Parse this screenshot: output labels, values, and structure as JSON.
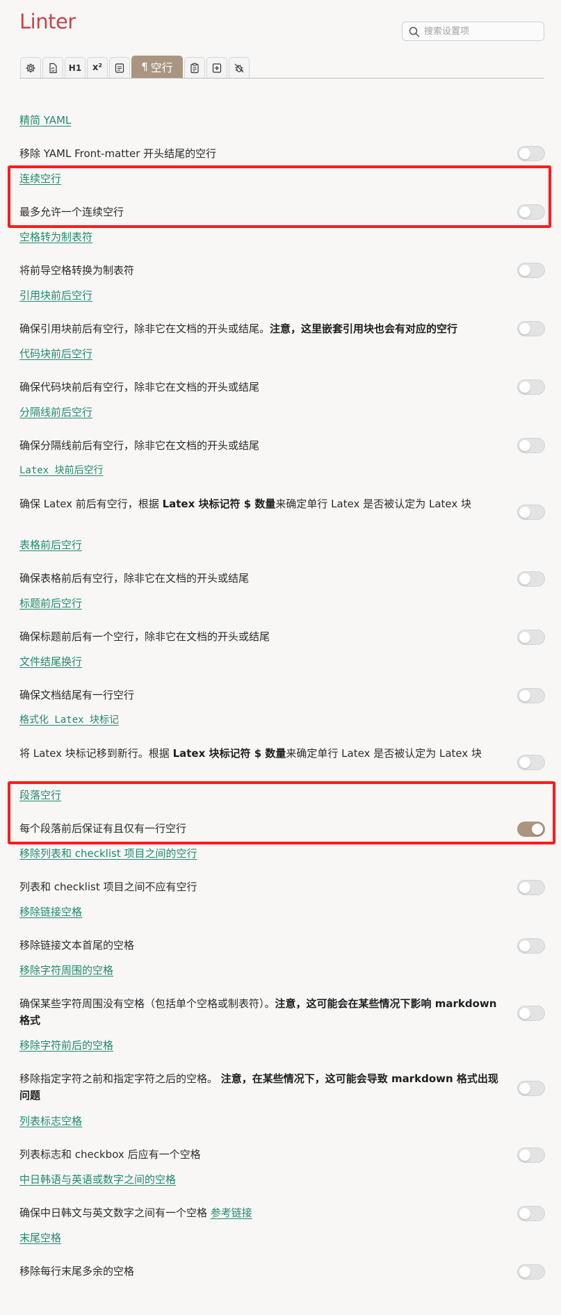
{
  "app": {
    "title": "Linter"
  },
  "search": {
    "placeholder": "搜索设置项",
    "value": ""
  },
  "tabs": [
    {
      "icon": "gear-icon",
      "label": ""
    },
    {
      "icon": "file-sync-icon",
      "label": ""
    },
    {
      "icon": "heading-icon",
      "label": "H1"
    },
    {
      "icon": "superscript-icon",
      "label": "x²"
    },
    {
      "icon": "file-text-icon",
      "label": ""
    },
    {
      "icon": "pilcrow-icon",
      "label": "空行",
      "active": true
    },
    {
      "icon": "clipboard-icon",
      "label": ""
    },
    {
      "icon": "file-plus-icon",
      "label": ""
    },
    {
      "icon": "bug-off-icon",
      "label": ""
    }
  ],
  "rules": [
    {
      "title": "精简 YAML",
      "desc": "移除 YAML Front-matter 开头结尾的空行",
      "enabled": false
    },
    {
      "title": "连续空行",
      "desc": "最多允许一个连续空行",
      "enabled": false
    },
    {
      "title": "空格转为制表符",
      "desc": "将前导空格转换为制表符",
      "enabled": false
    },
    {
      "title": "引用块前后空行",
      "desc_before": "确保引用块前后有空行，除非它在文档的开头或结尾。",
      "desc_bold": "注意，这里嵌套引用块也会有对应的空行",
      "enabled": false
    },
    {
      "title": "代码块前后空行",
      "desc": "确保代码块前后有空行，除非它在文档的开头或结尾",
      "enabled": false
    },
    {
      "title": "分隔线前后空行",
      "desc": "确保分隔线前后有空行，除非它在文档的开头或结尾",
      "enabled": false
    },
    {
      "title": "Latex 块前后空行",
      "desc_1": "确保 Latex 前后有空行，根据 ",
      "desc_2": "Latex 块标记符 $ 数量",
      "desc_3": "来确定单行 Latex 是否被认定为 Latex 块",
      "enabled": false
    },
    {
      "title": "表格前后空行",
      "desc": "确保表格前后有空行，除非它在文档的开头或结尾",
      "enabled": false
    },
    {
      "title": "标题前后空行",
      "desc": "确保标题前后有一个空行，除非它在文档的开头或结尾",
      "enabled": false
    },
    {
      "title": "文件结尾换行",
      "desc": "确保文档结尾有一行空行",
      "enabled": false
    },
    {
      "title": "格式化 Latex 块标记",
      "desc_1": "将 Latex 块标记移到新行。根据 ",
      "desc_2": "Latex 块标记符 $ 数量",
      "desc_3": "来确定单行 Latex 是否被认定为 Latex 块",
      "enabled": false
    },
    {
      "title": "段落空行",
      "desc": "每个段落前后保证有且仅有一行空行",
      "enabled": true
    },
    {
      "title": "移除列表和 checklist 项目之间的空行",
      "desc": "列表和 checklist 项目之间不应有空行",
      "enabled": false
    },
    {
      "title": "移除链接空格",
      "desc": "移除链接文本首尾的空格",
      "enabled": false
    },
    {
      "title": "移除字符周围的空格",
      "desc_before": "确保某些字符周围没有空格（包括单个空格或制表符）。",
      "desc_bold": "注意，这可能会在某些情况下影响 markdown 格式",
      "enabled": false
    },
    {
      "title": "移除字符前后的空格",
      "desc_before": "移除指定字符之前和指定字符之后的空格。 ",
      "desc_bold": "注意，在某些情况下，这可能会导致 markdown 格式出现问题",
      "enabled": false
    },
    {
      "title": "列表标志空格",
      "desc": "列表标志和 checkbox 后应有一个空格",
      "enabled": false
    },
    {
      "title": "中日韩语与英语或数字之间的空格",
      "desc": "确保中日韩文与英文数字之间有一个空格 ",
      "desc_link": "参考链接",
      "enabled": false
    },
    {
      "title": "末尾空格",
      "desc": "移除每行末尾多余的空格",
      "enabled": false
    }
  ],
  "colors": {
    "title": "#c64545",
    "link": "#1f8a6a",
    "accent": "#a99580",
    "highlight": "#ff1b1b"
  }
}
